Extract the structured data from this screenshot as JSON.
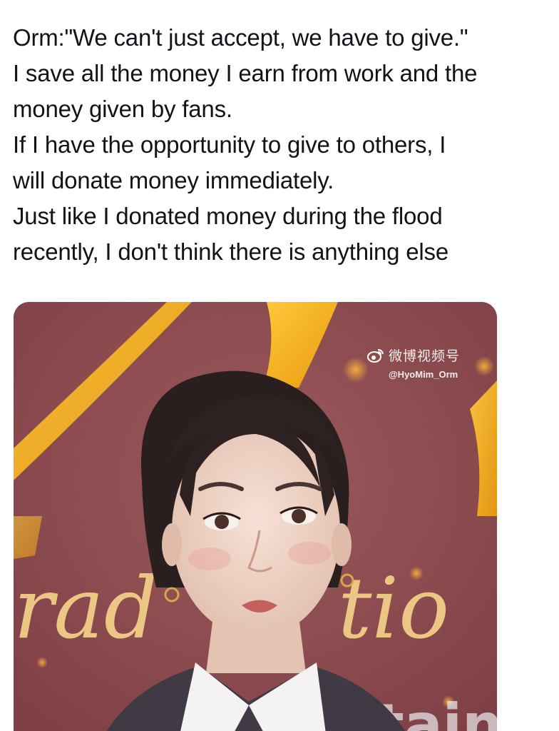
{
  "tweet": {
    "lines": [
      "Orm:\"We can't just accept, we have to give.\"",
      "I save all the money I earn from work and the",
      "money given by fans.",
      "If I have the opportunity to give to others, I",
      "will donate money immediately.",
      "Just like I donated money during the flood",
      "recently, I don't think there is anything else"
    ]
  },
  "media": {
    "watermark_brand": "微博视频号",
    "watermark_handle": "@HyoMim_Orm",
    "background_text": [
      "rad",
      "tio",
      "rtain"
    ],
    "icon": "weibo-logo-icon",
    "colors": {
      "backdrop": "#8a4a4f",
      "gold": "#f5b220",
      "text_gold": "#f7d58a"
    }
  }
}
